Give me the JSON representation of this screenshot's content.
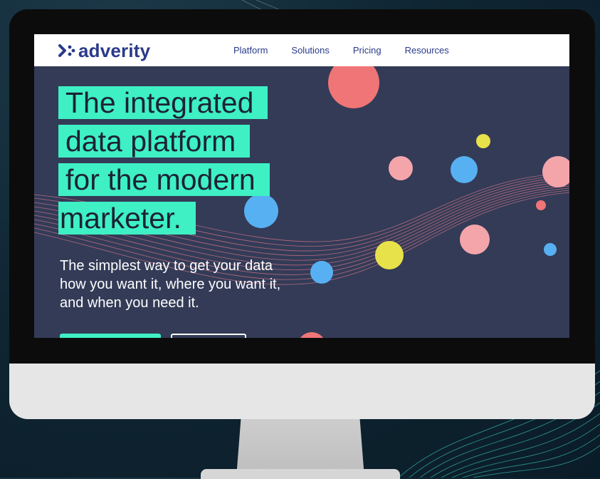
{
  "brand": {
    "name": "adverity",
    "color": "#2a3a8a"
  },
  "nav": {
    "items": [
      {
        "label": "Platform"
      },
      {
        "label": "Solutions"
      },
      {
        "label": "Pricing"
      },
      {
        "label": "Resources"
      }
    ]
  },
  "hero": {
    "headline_lines": [
      "The integrated",
      "data platform",
      "for the modern",
      "marketer."
    ],
    "subtext_lines": [
      "The simplest way to get your data",
      "how you want it, where you want it,",
      "and when you need it."
    ],
    "highlight_color": "#3ef0c4",
    "background_color": "#333b57"
  },
  "icons": {
    "logo": "adverity-logo-icon"
  }
}
